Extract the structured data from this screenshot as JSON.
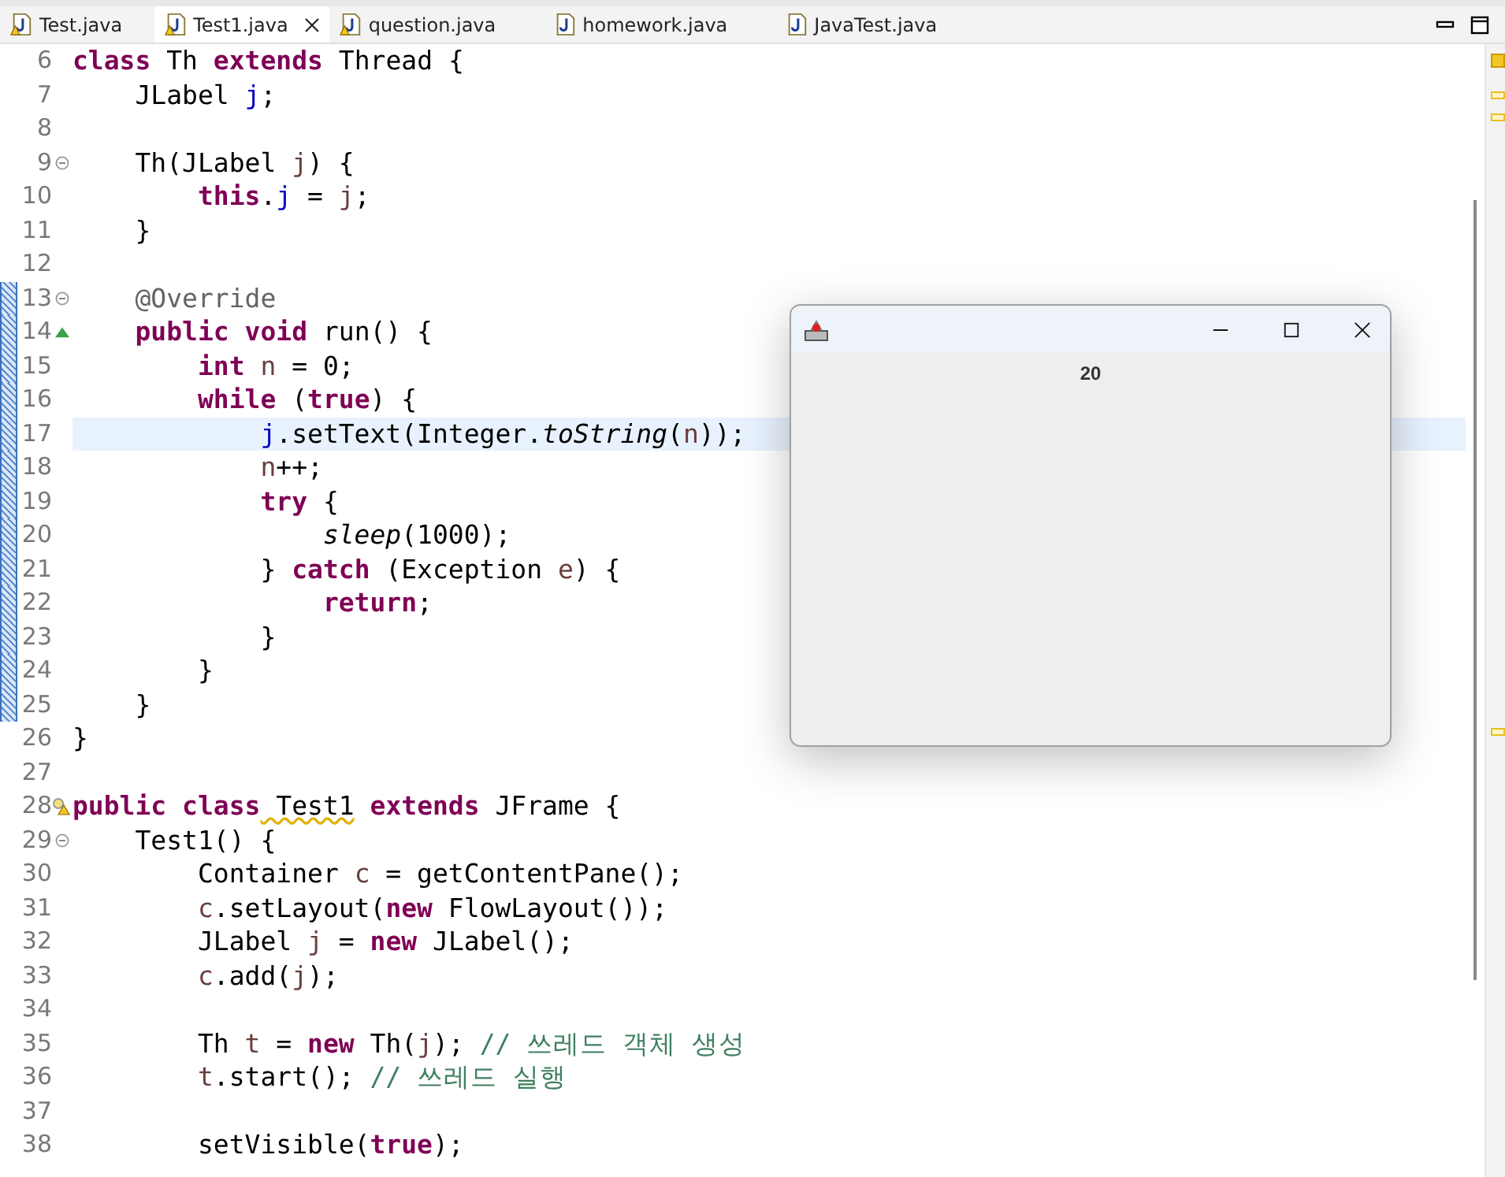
{
  "tabs": [
    {
      "label": "Test.java",
      "warning": true,
      "selected": false,
      "closable": false
    },
    {
      "label": "Test1.java",
      "warning": true,
      "selected": true,
      "closable": true
    },
    {
      "label": "question.java",
      "warning": true,
      "selected": false,
      "closable": false
    },
    {
      "label": "homework.java",
      "warning": false,
      "selected": false,
      "closable": false
    },
    {
      "label": "JavaTest.java",
      "warning": false,
      "selected": false,
      "closable": false
    }
  ],
  "editor": {
    "lines": [
      {
        "number": "6",
        "foldable": false,
        "overrides": false,
        "warning": false,
        "changed": false,
        "current": false,
        "tokens": [
          {
            "kind": "keyword",
            "text": "class"
          },
          {
            "kind": "text",
            "text": " Th "
          },
          {
            "kind": "keyword",
            "text": "extends"
          },
          {
            "kind": "text",
            "text": " Thread {"
          }
        ]
      },
      {
        "number": "7",
        "foldable": false,
        "overrides": false,
        "warning": false,
        "changed": false,
        "current": false,
        "tokens": [
          {
            "kind": "text",
            "text": "    JLabel "
          },
          {
            "kind": "field",
            "text": "j"
          },
          {
            "kind": "text",
            "text": ";"
          }
        ]
      },
      {
        "number": "8",
        "foldable": false,
        "overrides": false,
        "warning": false,
        "changed": false,
        "current": false
      },
      {
        "number": "9",
        "foldable": true,
        "overrides": false,
        "warning": false,
        "changed": false,
        "current": false,
        "tokens": [
          {
            "kind": "text",
            "text": "    Th(JLabel "
          },
          {
            "kind": "variable",
            "text": "j"
          },
          {
            "kind": "text",
            "text": ") {"
          }
        ]
      },
      {
        "number": "10",
        "foldable": false,
        "overrides": false,
        "warning": false,
        "changed": false,
        "current": false,
        "tokens": [
          {
            "kind": "keyword",
            "text": "        this"
          },
          {
            "kind": "text",
            "text": "."
          },
          {
            "kind": "field",
            "text": "j"
          },
          {
            "kind": "text",
            "text": " = "
          },
          {
            "kind": "variable",
            "text": "j"
          },
          {
            "kind": "text",
            "text": ";"
          }
        ]
      },
      {
        "number": "11",
        "foldable": false,
        "overrides": false,
        "warning": false,
        "changed": false,
        "current": false,
        "tokens": [
          {
            "kind": "text",
            "text": "    }"
          }
        ]
      },
      {
        "number": "12",
        "foldable": false,
        "overrides": false,
        "warning": false,
        "changed": false,
        "current": false
      },
      {
        "number": "13",
        "foldable": true,
        "overrides": false,
        "warning": false,
        "changed": true,
        "current": false,
        "tokens": [
          {
            "kind": "annotation",
            "text": "    @Override"
          }
        ]
      },
      {
        "number": "14",
        "foldable": false,
        "overrides": true,
        "warning": false,
        "changed": true,
        "current": false,
        "tokens": [
          {
            "kind": "keyword",
            "text": "    public void"
          },
          {
            "kind": "text",
            "text": " run() {"
          }
        ]
      },
      {
        "number": "15",
        "foldable": false,
        "overrides": false,
        "warning": false,
        "changed": true,
        "current": false,
        "tokens": [
          {
            "kind": "keyword",
            "text": "        int"
          },
          {
            "kind": "variable",
            "text": " n"
          },
          {
            "kind": "text",
            "text": " = 0;"
          }
        ]
      },
      {
        "number": "16",
        "foldable": false,
        "overrides": false,
        "warning": false,
        "changed": true,
        "current": false,
        "tokens": [
          {
            "kind": "keyword",
            "text": "        while"
          },
          {
            "kind": "text",
            "text": " ("
          },
          {
            "kind": "keyword",
            "text": "true"
          },
          {
            "kind": "text",
            "text": ") {"
          }
        ]
      },
      {
        "number": "17",
        "foldable": false,
        "overrides": false,
        "warning": false,
        "changed": true,
        "current": true,
        "tokens": [
          {
            "kind": "field",
            "text": "            j"
          },
          {
            "kind": "text",
            "text": ".setText(Integer."
          },
          {
            "kind": "static-method",
            "text": "toString"
          },
          {
            "kind": "text",
            "text": "("
          },
          {
            "kind": "variable",
            "text": "n"
          },
          {
            "kind": "text",
            "text": "));"
          }
        ]
      },
      {
        "number": "18",
        "foldable": false,
        "overrides": false,
        "warning": false,
        "changed": true,
        "current": false,
        "tokens": [
          {
            "kind": "variable",
            "text": "            n"
          },
          {
            "kind": "text",
            "text": "++;"
          }
        ]
      },
      {
        "number": "19",
        "foldable": false,
        "overrides": false,
        "warning": false,
        "changed": true,
        "current": false,
        "tokens": [
          {
            "kind": "keyword",
            "text": "            try"
          },
          {
            "kind": "text",
            "text": " {"
          }
        ]
      },
      {
        "number": "20",
        "foldable": false,
        "overrides": false,
        "warning": false,
        "changed": true,
        "current": false,
        "tokens": [
          {
            "kind": "static-method",
            "text": "                sleep"
          },
          {
            "kind": "text",
            "text": "(1000);"
          }
        ]
      },
      {
        "number": "21",
        "foldable": false,
        "overrides": false,
        "warning": false,
        "changed": true,
        "current": false,
        "tokens": [
          {
            "kind": "text",
            "text": "            } "
          },
          {
            "kind": "keyword",
            "text": "catch"
          },
          {
            "kind": "text",
            "text": " (Exception "
          },
          {
            "kind": "variable",
            "text": "e"
          },
          {
            "kind": "text",
            "text": ") {"
          }
        ]
      },
      {
        "number": "22",
        "foldable": false,
        "overrides": false,
        "warning": false,
        "changed": true,
        "current": false,
        "tokens": [
          {
            "kind": "keyword",
            "text": "                return"
          },
          {
            "kind": "text",
            "text": ";"
          }
        ]
      },
      {
        "number": "23",
        "foldable": false,
        "overrides": false,
        "warning": false,
        "changed": true,
        "current": false,
        "tokens": [
          {
            "kind": "text",
            "text": "            }"
          }
        ]
      },
      {
        "number": "24",
        "foldable": false,
        "overrides": false,
        "warning": false,
        "changed": true,
        "current": false,
        "tokens": [
          {
            "kind": "text",
            "text": "        }"
          }
        ]
      },
      {
        "number": "25",
        "foldable": false,
        "overrides": false,
        "warning": false,
        "changed": true,
        "current": false,
        "tokens": [
          {
            "kind": "text",
            "text": "    }"
          }
        ]
      },
      {
        "number": "26",
        "foldable": false,
        "overrides": false,
        "warning": false,
        "changed": false,
        "current": false,
        "tokens": [
          {
            "kind": "text",
            "text": "}"
          }
        ]
      },
      {
        "number": "27",
        "foldable": false,
        "overrides": false,
        "warning": false,
        "changed": false,
        "current": false
      },
      {
        "number": "28",
        "foldable": false,
        "overrides": false,
        "warning": true,
        "changed": false,
        "current": false,
        "tokens": [
          {
            "kind": "keyword",
            "text": "public class"
          },
          {
            "kind": "warning-text",
            "text": " Test1"
          },
          {
            "kind": "keyword",
            "text": " extends"
          },
          {
            "kind": "text",
            "text": " JFrame {"
          }
        ]
      },
      {
        "number": "29",
        "foldable": true,
        "overrides": false,
        "warning": false,
        "changed": false,
        "current": false,
        "tokens": [
          {
            "kind": "text",
            "text": "    Test1() {"
          }
        ]
      },
      {
        "number": "30",
        "foldable": false,
        "overrides": false,
        "warning": false,
        "changed": false,
        "current": false,
        "tokens": [
          {
            "kind": "text",
            "text": "        Container "
          },
          {
            "kind": "variable",
            "text": "c"
          },
          {
            "kind": "text",
            "text": " = getContentPane();"
          }
        ]
      },
      {
        "number": "31",
        "foldable": false,
        "overrides": false,
        "warning": false,
        "changed": false,
        "current": false,
        "tokens": [
          {
            "kind": "variable",
            "text": "        c"
          },
          {
            "kind": "text",
            "text": ".setLayout("
          },
          {
            "kind": "keyword",
            "text": "new"
          },
          {
            "kind": "text",
            "text": " FlowLayout());"
          }
        ]
      },
      {
        "number": "32",
        "foldable": false,
        "overrides": false,
        "warning": false,
        "changed": false,
        "current": false,
        "tokens": [
          {
            "kind": "text",
            "text": "        JLabel "
          },
          {
            "kind": "variable",
            "text": "j"
          },
          {
            "kind": "text",
            "text": " = "
          },
          {
            "kind": "keyword",
            "text": "new"
          },
          {
            "kind": "text",
            "text": " JLabel();"
          }
        ]
      },
      {
        "number": "33",
        "foldable": false,
        "overrides": false,
        "warning": false,
        "changed": false,
        "current": false,
        "tokens": [
          {
            "kind": "variable",
            "text": "        c"
          },
          {
            "kind": "text",
            "text": ".add("
          },
          {
            "kind": "variable",
            "text": "j"
          },
          {
            "kind": "text",
            "text": ");"
          }
        ]
      },
      {
        "number": "34",
        "foldable": false,
        "overrides": false,
        "warning": false,
        "changed": false,
        "current": false
      },
      {
        "number": "35",
        "foldable": false,
        "overrides": false,
        "warning": false,
        "changed": false,
        "current": false,
        "tokens": [
          {
            "kind": "text",
            "text": "        Th "
          },
          {
            "kind": "variable",
            "text": "t"
          },
          {
            "kind": "text",
            "text": " = "
          },
          {
            "kind": "keyword",
            "text": "new"
          },
          {
            "kind": "text",
            "text": " Th("
          },
          {
            "kind": "variable",
            "text": "j"
          },
          {
            "kind": "text",
            "text": "); "
          },
          {
            "kind": "comment",
            "text": "// 쓰레드 객체 생성"
          }
        ]
      },
      {
        "number": "36",
        "foldable": false,
        "overrides": false,
        "warning": false,
        "changed": false,
        "current": false,
        "tokens": [
          {
            "kind": "variable",
            "text": "        t"
          },
          {
            "kind": "text",
            "text": ".start(); "
          },
          {
            "kind": "comment",
            "text": "// 쓰레드 실행"
          }
        ]
      },
      {
        "number": "37",
        "foldable": false,
        "overrides": false,
        "warning": false,
        "changed": false,
        "current": false
      },
      {
        "number": "38",
        "foldable": false,
        "overrides": false,
        "warning": false,
        "changed": false,
        "current": false,
        "tokens": [
          {
            "kind": "text",
            "text": "        setVisible("
          },
          {
            "kind": "keyword",
            "text": "true"
          },
          {
            "kind": "text",
            "text": ");"
          }
        ]
      }
    ]
  },
  "popup_window": {
    "label": "20"
  }
}
